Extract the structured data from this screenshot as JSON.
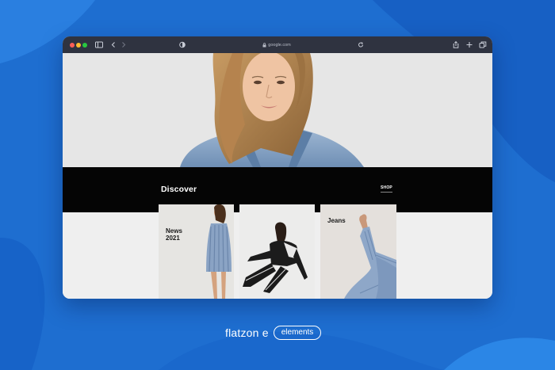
{
  "browser": {
    "url": "google.com"
  },
  "page": {
    "section_title": "Discover",
    "shop_link": "SHOP",
    "cards": [
      {
        "title": "News\n2021"
      },
      {
        "title": ""
      },
      {
        "title": "Jeans"
      }
    ]
  },
  "footer": {
    "brand": "flatzon e",
    "badge": "elements"
  },
  "colors": {
    "background": "#1e6fd0",
    "titlebar": "#2f3340",
    "band": "#050505"
  }
}
